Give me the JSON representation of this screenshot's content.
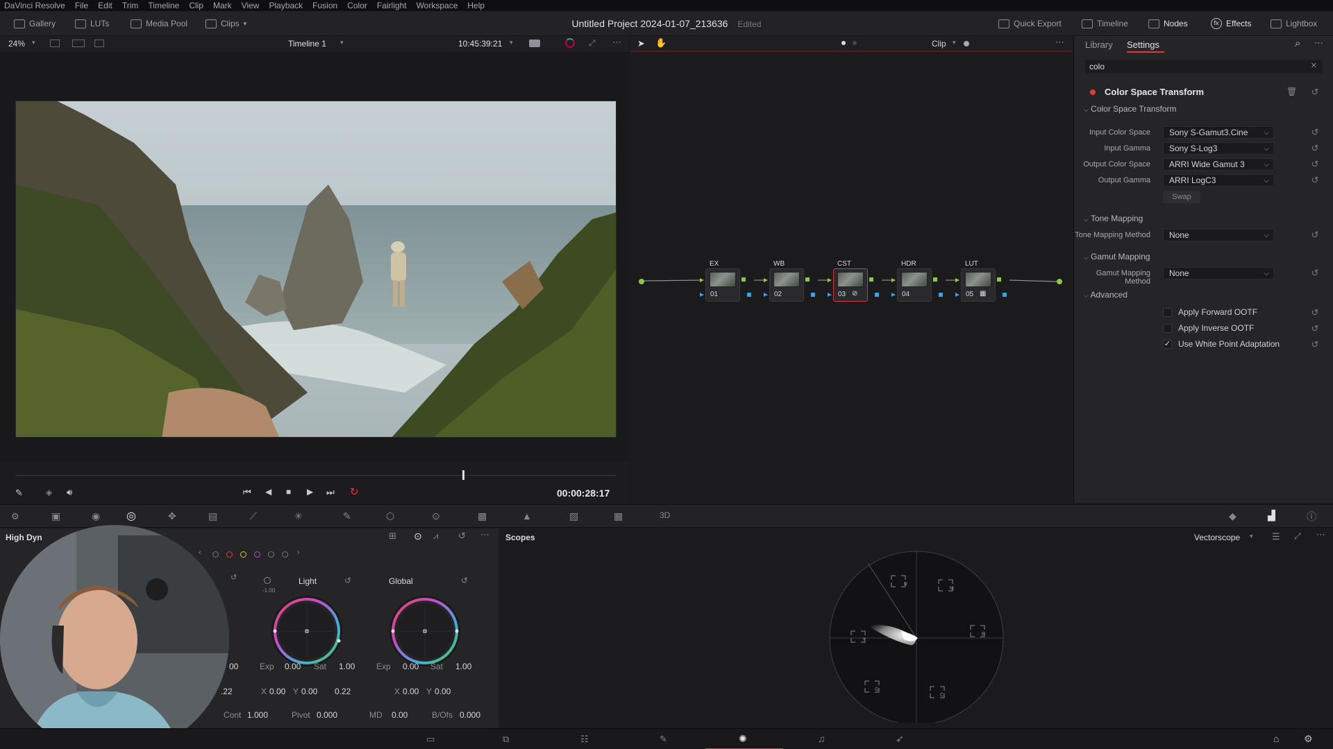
{
  "menu": [
    "DaVinci Resolve",
    "File",
    "Edit",
    "Trim",
    "Timeline",
    "Clip",
    "Mark",
    "View",
    "Playback",
    "Fusion",
    "Color",
    "Fairlight",
    "Workspace",
    "Help"
  ],
  "header": {
    "left_buttons": [
      "Gallery",
      "LUTs",
      "Media Pool",
      "Clips"
    ],
    "project_title": "Untitled Project 2024-01-07_213636",
    "edited": "Edited",
    "right_buttons": [
      "Quick Export",
      "Timeline",
      "Nodes",
      "Effects",
      "Lightbox"
    ]
  },
  "viewer": {
    "zoom": "24%",
    "timeline_name": "Timeline 1",
    "source_timecode": "10:45:39:21",
    "playhead_timecode": "00:00:28:17"
  },
  "node_editor": {
    "mode": "Clip",
    "nodes": [
      {
        "label": "EX",
        "id": "01"
      },
      {
        "label": "WB",
        "id": "02"
      },
      {
        "label": "CST",
        "id": "03"
      },
      {
        "label": "HDR",
        "id": "04"
      },
      {
        "label": "LUT",
        "id": "05"
      }
    ]
  },
  "effects_panel": {
    "tabs": [
      "Library",
      "Settings"
    ],
    "active_tab": "Settings",
    "search_value": "colo",
    "effect_name": "Color Space Transform",
    "sections": {
      "cst": "Color Space Transform",
      "tone": "Tone Mapping",
      "gamut": "Gamut Mapping",
      "advanced": "Advanced"
    },
    "fields": {
      "input_color_space": {
        "label": "Input Color Space",
        "value": "Sony S-Gamut3.Cine"
      },
      "input_gamma": {
        "label": "Input Gamma",
        "value": "Sony S-Log3"
      },
      "output_color_space": {
        "label": "Output Color Space",
        "value": "ARRI Wide Gamut 3"
      },
      "output_gamma": {
        "label": "Output Gamma",
        "value": "ARRI LogC3"
      },
      "tone_mapping_method": {
        "label": "Tone Mapping Method",
        "value": "None"
      },
      "gamut_mapping_method": {
        "label": "Gamut Mapping Method",
        "value": "None"
      }
    },
    "swap_label": "Swap",
    "checkboxes": [
      {
        "label": "Apply Forward OOTF",
        "checked": false
      },
      {
        "label": "Apply Inverse OOTF",
        "checked": false
      },
      {
        "label": "Use White Point Adaptation",
        "checked": true
      }
    ]
  },
  "hdr_panel": {
    "title": "High Dyn",
    "wheels": [
      {
        "name": "Light",
        "exp": "0.00",
        "sat": "1.00",
        "x": "0.00",
        "y": "0.00",
        "z": "0.22",
        "top_value": "-1.00"
      },
      {
        "name": "Global",
        "exp": "0.00",
        "sat": "1.00",
        "x": "0.00",
        "y": "0.00"
      }
    ],
    "partial_left": {
      "v1": "00",
      "v2": ".22"
    },
    "labels": {
      "exp": "Exp",
      "sat": "Sat",
      "x": "X",
      "y": "Y",
      "cont": "Cont",
      "pivot": "Pivot",
      "md": "MD",
      "bofs": "B/Ofs"
    },
    "bottom": {
      "cont": "1.000",
      "pivot": "0.000",
      "md": "0.00",
      "bofs": "0.000"
    }
  },
  "scopes": {
    "title": "Scopes",
    "type": "Vectorscope",
    "targets": [
      "R",
      "M",
      "B",
      "C",
      "G",
      "Y"
    ]
  },
  "colors": {
    "accent_red": "#e03a3a",
    "bg": "#1c1c1f",
    "panel": "#252528"
  }
}
